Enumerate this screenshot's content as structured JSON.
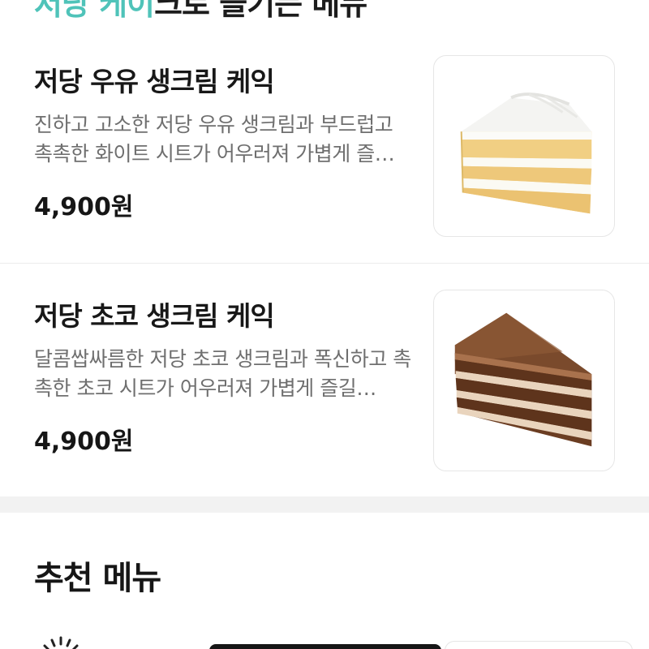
{
  "top_heading": {
    "accent_text": "저당 케이",
    "rest_text": "크로 즐기는 메뉴"
  },
  "items": [
    {
      "name": "저당 우유 생크림 케익",
      "description": "진하고 고소한 저당 우유 생크림과 부드럽고 촉촉한 화이트 시트가 어우러져 가볍게 즐…",
      "price": "4,900원",
      "image_icon": "vanilla-cake-slice"
    },
    {
      "name": "저당 초코 생크림 케익",
      "description": "달콤쌉싸름한 저당 초코 생크림과 폭신하고 촉촉한 초코 시트가 어우러져 가볍게 즐길…",
      "price": "4,900원",
      "image_icon": "chocolate-cake-slice"
    }
  ],
  "recommended": {
    "title": "추천 메뉴"
  },
  "colors": {
    "accent": "#4fc3b9",
    "divider": "#f2f2f2",
    "description": "#6f6f6f"
  }
}
